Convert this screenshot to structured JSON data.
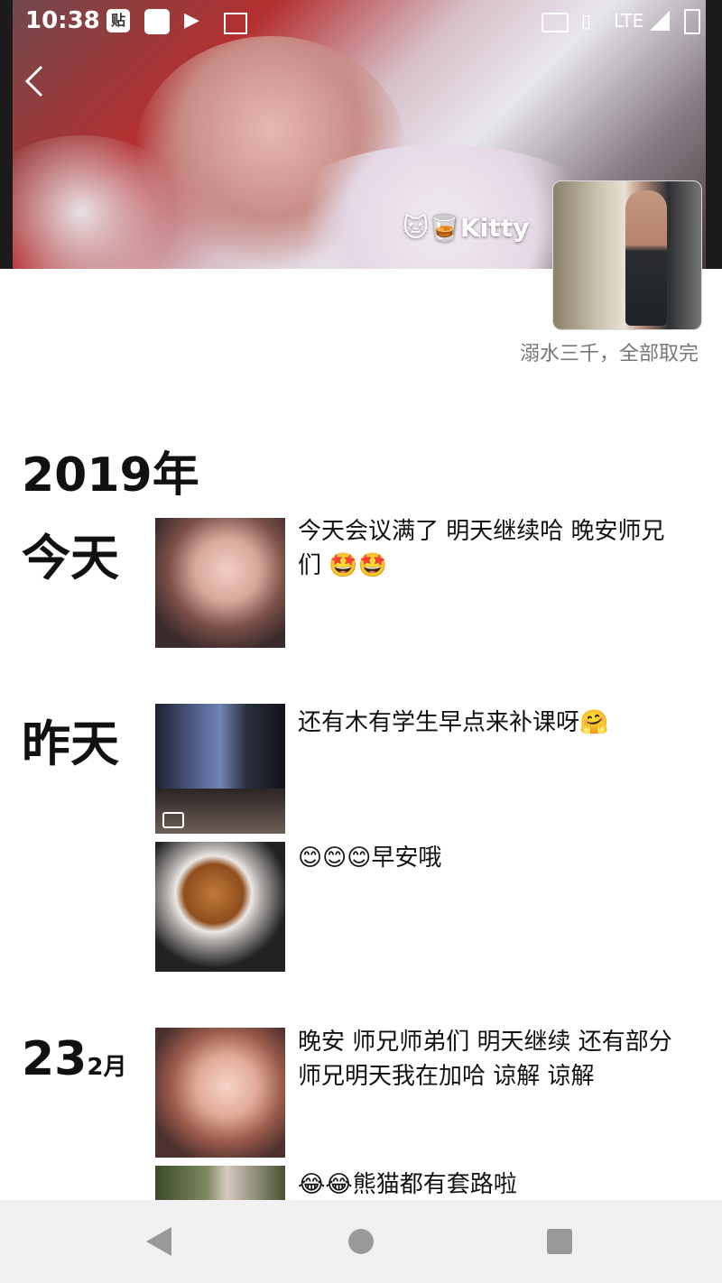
{
  "statusbar": {
    "time": "10:38",
    "tie_icon": "贴",
    "network": "LTE"
  },
  "profile": {
    "nickname": "🐱🥃Kitty",
    "signature": "溺水三千，全部取完"
  },
  "timeline": {
    "year": "2019年",
    "days": [
      {
        "label": "今天",
        "posts": [
          {
            "text": "今天会议满了  明天继续哈  晚安师兄们 🤩🤩"
          }
        ]
      },
      {
        "label": "昨天",
        "posts": [
          {
            "text": "还有木有学生早点来补课呀🤗",
            "video": true
          },
          {
            "text": "😊😊😊早安哦"
          }
        ]
      },
      {
        "day": "23",
        "month": "2月",
        "posts": [
          {
            "text": "晚安 师兄师弟们  明天继续  还有部分师兄明天我在加哈  谅解 谅解"
          },
          {
            "text": "😂😂熊猫都有套路啦"
          }
        ]
      }
    ]
  },
  "navbar": {
    "back": "back-triangle",
    "home": "home-circle",
    "recents": "recents-square"
  }
}
